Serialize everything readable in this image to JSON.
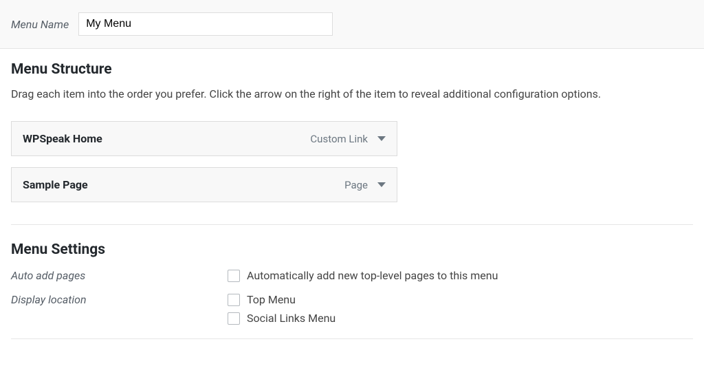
{
  "header": {
    "menu_name_label": "Menu Name",
    "menu_name_value": "My Menu"
  },
  "structure": {
    "heading": "Menu Structure",
    "description": "Drag each item into the order you prefer. Click the arrow on the right of the item to reveal additional configuration options.",
    "items": [
      {
        "title": "WPSpeak Home",
        "type": "Custom Link"
      },
      {
        "title": "Sample Page",
        "type": "Page"
      }
    ]
  },
  "settings": {
    "heading": "Menu Settings",
    "auto_add": {
      "label": "Auto add pages",
      "option": "Automatically add new top-level pages to this menu"
    },
    "display_location": {
      "label": "Display location",
      "options": [
        "Top Menu",
        "Social Links Menu"
      ]
    }
  }
}
